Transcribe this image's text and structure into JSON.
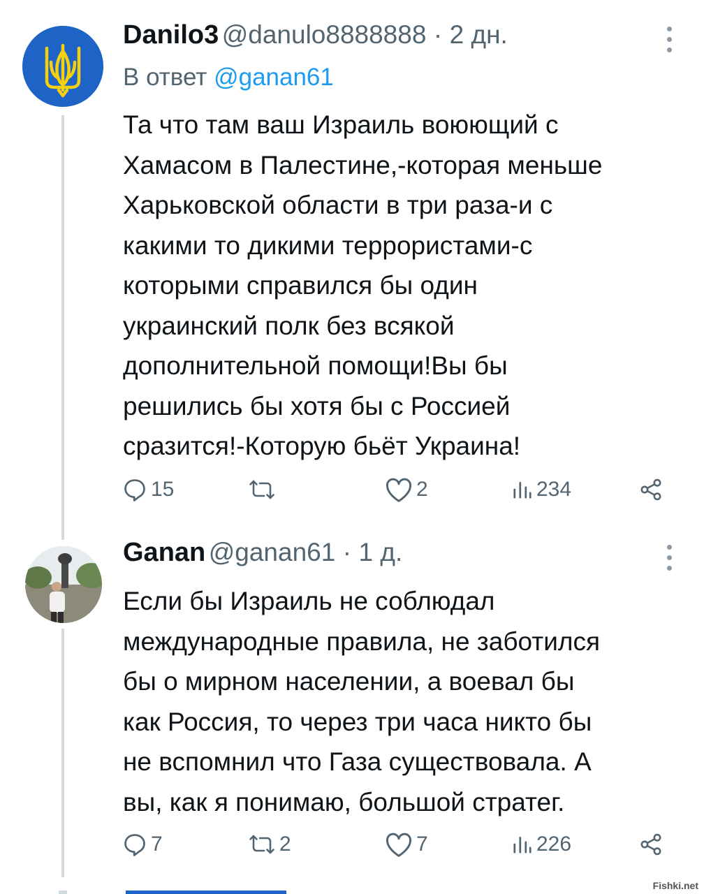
{
  "tweets": [
    {
      "display_name": "Danilo3",
      "handle": "@danulo8888888",
      "separator": "·",
      "time": "2 дн.",
      "reply_prefix": "В ответ",
      "reply_handle": "@ganan61",
      "avatar_icon": "ukraine-trident-icon",
      "lines": [
        "Та что там ваш Израиль воюющий с",
        "Хамасом в Палестине,-которая меньше",
        "Харьковской области в три раза-и с",
        "какими то дикими террористами-с",
        "которыми справился бы один",
        "украинский полк без всякой",
        "дополнительной помощи!Вы бы",
        "решились бы хотя бы с Россией",
        "сразится!-Которую бьёт Украина!"
      ],
      "stats": {
        "replies": "15",
        "retweets": "",
        "likes": "2",
        "views": "234"
      }
    },
    {
      "display_name": "Ganan",
      "handle": "@ganan61",
      "separator": "·",
      "time": "1 д.",
      "avatar_icon": "user-photo-avatar",
      "lines": [
        "Если бы Израиль не соблюдал",
        "международные правила, не заботился",
        "бы о мирном населении, а воевал бы",
        "как Россия, то через три часа никто бы",
        "не вспомнил что Газа существовала. А",
        "вы, как я понимаю, большой стратег."
      ],
      "stats": {
        "replies": "7",
        "retweets": "2",
        "likes": "7",
        "views": "226"
      }
    }
  ],
  "watermark": "Fishki.net",
  "colors": {
    "text": "#0f1419",
    "secondary": "#536471",
    "link": "#1d9bf0",
    "avatar_blue": "#1d64c6",
    "trident_yellow": "#f5d00f"
  }
}
